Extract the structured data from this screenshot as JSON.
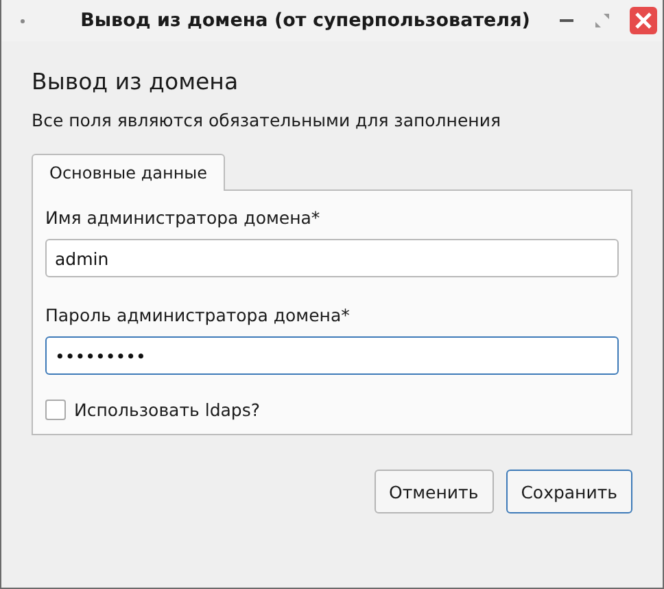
{
  "window": {
    "title": "Вывод из домена (от суперпользователя)"
  },
  "heading": "Вывод из домена",
  "subtitle": "Все поля являются обязательными для заполнения",
  "tabs": [
    {
      "label": "Основные данные",
      "selected": true
    }
  ],
  "fields": [
    {
      "label": "Имя администратора домена*",
      "value": "admin",
      "focused": false
    },
    {
      "label": "Пароль администратора домена*",
      "value": "•••••••••",
      "focused": true
    }
  ],
  "checkbox": {
    "label": "Использовать ldaps?",
    "checked": false
  },
  "buttons": [
    {
      "label": "Отменить",
      "kind": "plain"
    },
    {
      "label": "Сохранить",
      "kind": "default"
    }
  ]
}
